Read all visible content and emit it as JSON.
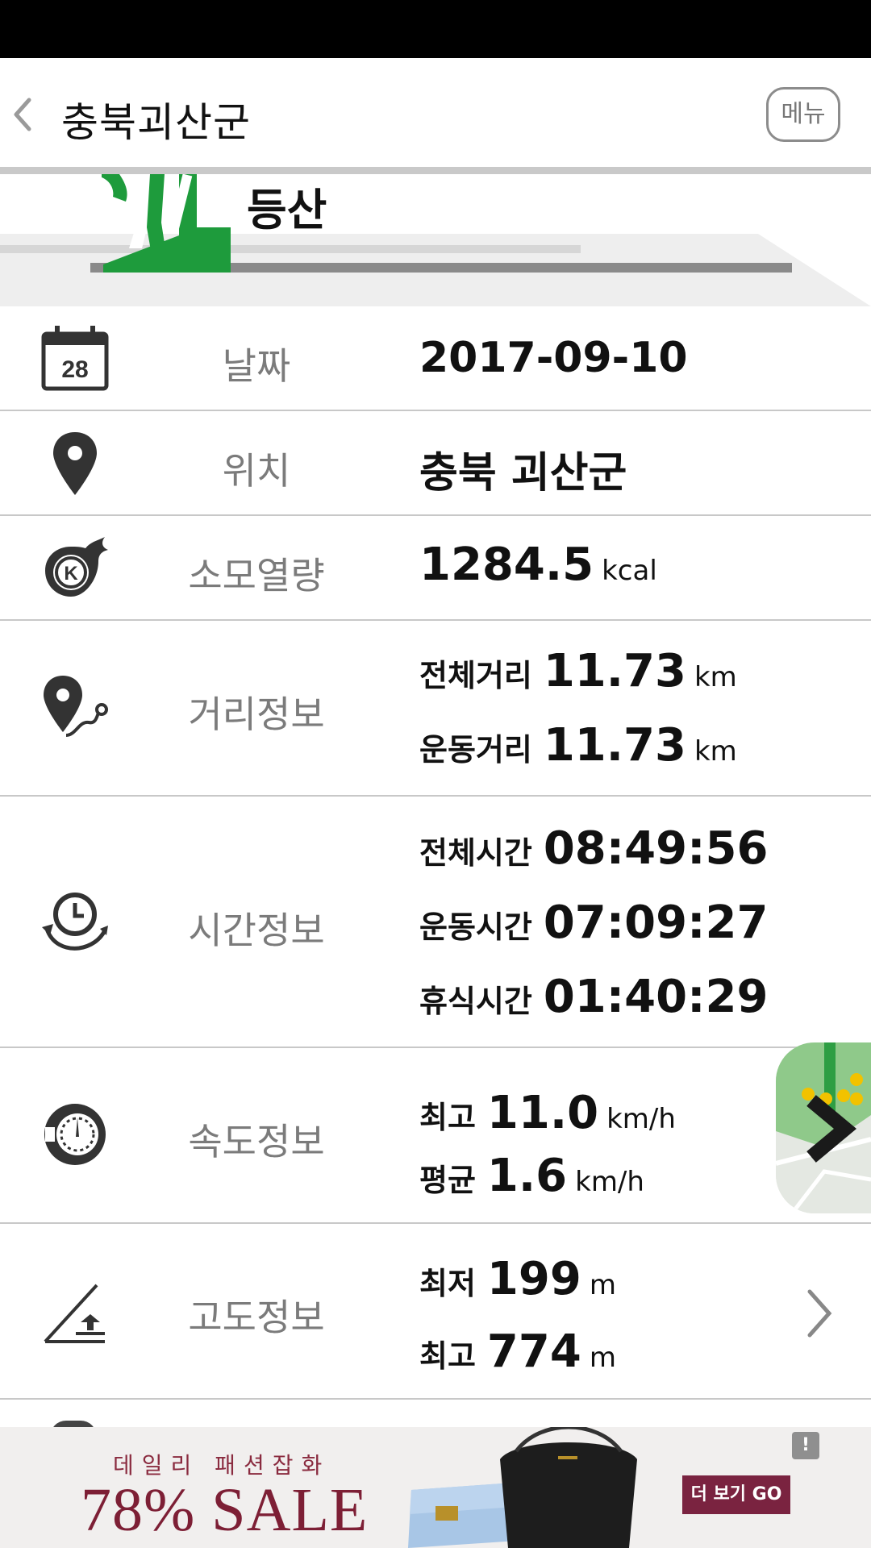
{
  "header": {
    "back_icon": "chevron-left-icon",
    "title": "충북괴산군",
    "menu_label": "메뉴"
  },
  "activity": {
    "label": "등산",
    "icon": "hiking-icon"
  },
  "rows": {
    "date": {
      "icon": "calendar-icon",
      "icon_text": "28",
      "label": "날짜",
      "value": "2017-09-10"
    },
    "location": {
      "icon": "location-pin-icon",
      "label": "위치",
      "value": "충북 괴산군"
    },
    "calories": {
      "icon": "calorie-flame-icon",
      "icon_text": "K",
      "label": "소모열량",
      "value": "1284.5",
      "unit": "kcal"
    },
    "distance": {
      "icon": "route-pin-icon",
      "label": "거리정보",
      "items": [
        {
          "label": "전체거리",
          "value": "11.73",
          "unit": "km"
        },
        {
          "label": "운동거리",
          "value": "11.73",
          "unit": "km"
        }
      ]
    },
    "time": {
      "icon": "clock-cycle-icon",
      "label": "시간정보",
      "items": [
        {
          "label": "전체시간",
          "value": "08:49:56"
        },
        {
          "label": "운동시간",
          "value": "07:09:27"
        },
        {
          "label": "휴식시간",
          "value": "01:40:29"
        }
      ]
    },
    "speed": {
      "icon": "speedometer-icon",
      "label": "속도정보",
      "items": [
        {
          "label": "최고",
          "value": "11.0",
          "unit": "km/h"
        },
        {
          "label": "평균",
          "value": "1.6",
          "unit": "km/h"
        }
      ]
    },
    "altitude": {
      "icon": "altitude-slope-icon",
      "label": "고도정보",
      "items": [
        {
          "label": "최저",
          "value": "199",
          "unit": "m"
        },
        {
          "label": "최고",
          "value": "774",
          "unit": "m"
        }
      ],
      "chevron_icon": "chevron-right-icon"
    }
  },
  "map_thumbnail": {
    "icon": "chevron-right-icon",
    "colors": {
      "park": "#8fc98a",
      "route": "#2e9e43",
      "marker": "#f2c200"
    }
  },
  "ad": {
    "tagline": "데일리 패션잡화",
    "headline": "78% SALE",
    "button": "더 보기 GO",
    "info_icon": "!",
    "colors": {
      "brand": "#7a2340",
      "bg": "#f1efee"
    }
  },
  "colors": {
    "accent_green": "#1e9b3c",
    "label_gray": "#7b7b7b",
    "divider": "#c8c8c8"
  }
}
